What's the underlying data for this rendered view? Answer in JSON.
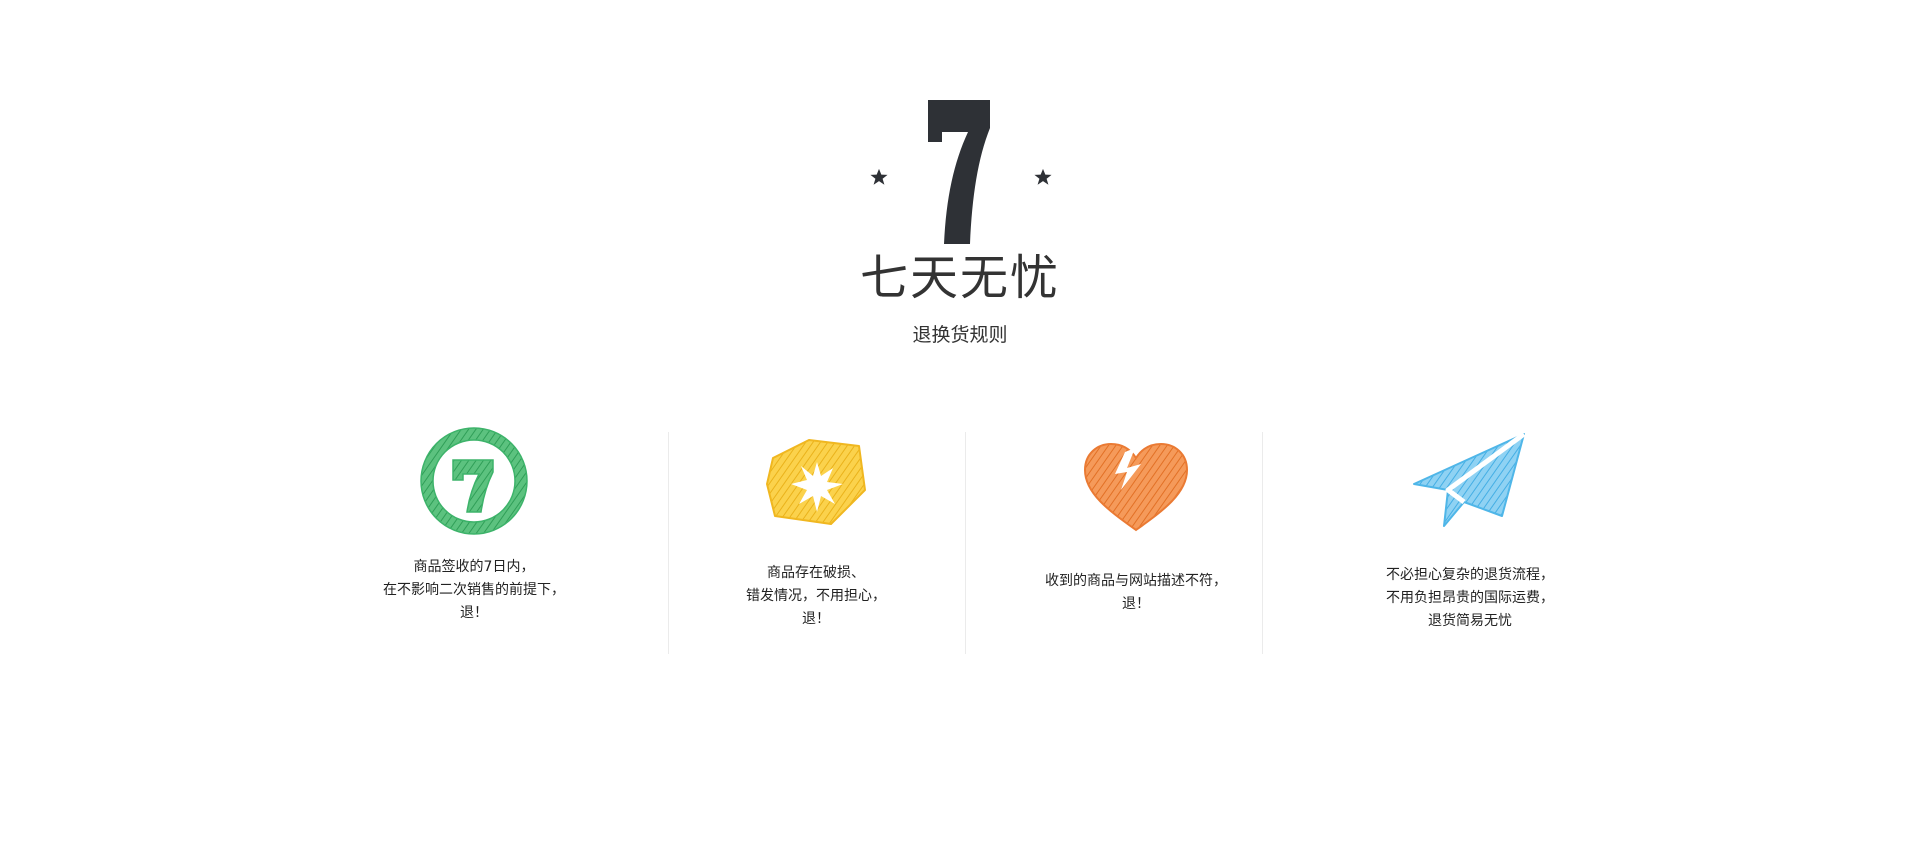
{
  "hero": {
    "title": "七天无忧",
    "subtitle": "退换货规则"
  },
  "features": [
    {
      "icon": "circle-seven-icon",
      "color": "#3db36a",
      "lines": [
        "商品签收的7日内，",
        "在不影响二次销售的前提下，",
        "退！"
      ]
    },
    {
      "icon": "damaged-box-icon",
      "color": "#f7c42b",
      "lines": [
        "商品存在破损、",
        "错发情况，不用担心，",
        "退！"
      ]
    },
    {
      "icon": "broken-heart-icon",
      "color": "#f0843a",
      "lines": [
        "收到的商品与网站描述不符，",
        "退！"
      ]
    },
    {
      "icon": "paper-plane-icon",
      "color": "#4fb6e8",
      "lines": [
        "不必担心复杂的退货流程，",
        "不用负担昂贵的国际运费，",
        "退货简易无忧"
      ]
    }
  ]
}
